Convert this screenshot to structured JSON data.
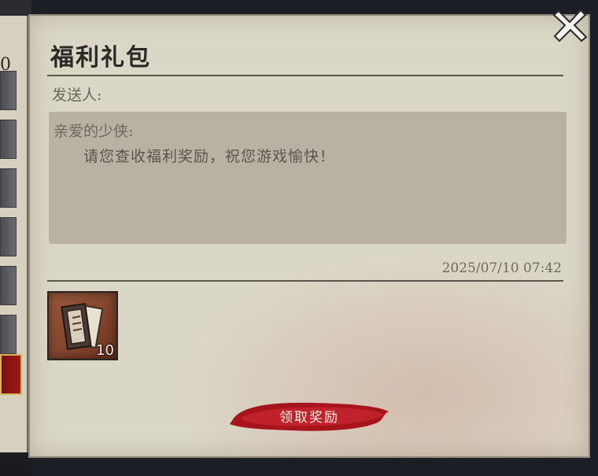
{
  "mail": {
    "title": "福利礼包",
    "sender_label": "发送人:",
    "greeting": "亲爱的少侠:",
    "body": "请您查收福利奖励，祝您游戏愉快！",
    "timestamp": "2025/07/10 07:42"
  },
  "attachment": {
    "icon": "scroll-icon",
    "count": "10"
  },
  "claim_button": {
    "label": "领取奖励"
  },
  "side_list": {
    "count_fragment": "0"
  },
  "colors": {
    "paper": "#dbd7c7",
    "message_box": "#b8b1a4",
    "brush_red": "#b3202a",
    "selected_tab": "#a11818"
  }
}
